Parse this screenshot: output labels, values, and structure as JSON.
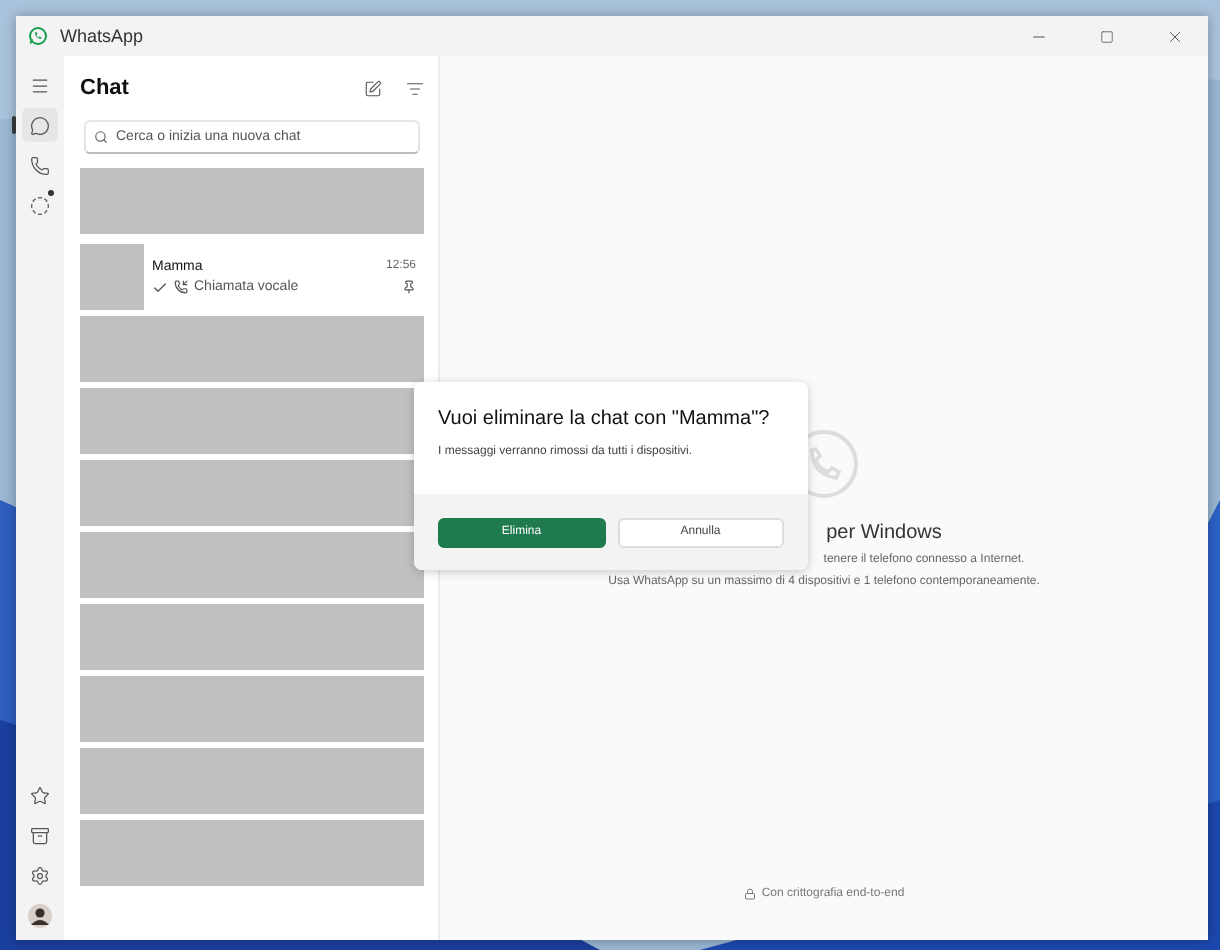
{
  "window": {
    "title": "WhatsApp"
  },
  "rail": {
    "top": [
      {
        "kind": "menu",
        "selected": false
      },
      {
        "kind": "chats",
        "selected": true
      },
      {
        "kind": "calls",
        "selected": false
      },
      {
        "kind": "status",
        "selected": false,
        "badge": true
      }
    ],
    "bottom": [
      {
        "kind": "starred",
        "selected": false
      },
      {
        "kind": "archived",
        "selected": false
      },
      {
        "kind": "settings",
        "selected": false
      },
      {
        "kind": "profile",
        "selected": false
      }
    ]
  },
  "chat_list": {
    "title": "Chat",
    "search": {
      "placeholder": "Cerca o inizia una nuova chat"
    },
    "chats": [
      {
        "kind": "hidden"
      },
      {
        "kind": "chat",
        "name": "Mamma",
        "time": "12:56",
        "preview": "Chiamata vocale",
        "read": true,
        "pinned": true
      },
      {
        "kind": "hidden"
      },
      {
        "kind": "hidden"
      },
      {
        "kind": "hidden"
      },
      {
        "kind": "hidden"
      },
      {
        "kind": "hidden"
      },
      {
        "kind": "hidden"
      },
      {
        "kind": "hidden"
      },
      {
        "kind": "hidden"
      }
    ]
  },
  "main": {
    "title": "per Windows",
    "lines": [
      "tenere il telefono connesso a Internet.",
      "Usa WhatsApp su un massimo di 4 dispositivi e 1 telefono contemporaneamente."
    ],
    "footer": "Con crittografia end-to-end"
  },
  "dialog": {
    "title": "Vuoi eliminare la chat con \"Mamma\"?",
    "message": "I messaggi verranno rimossi da tutti i dispositivi.",
    "buttons": [
      {
        "label": "Elimina",
        "kind": "primary"
      },
      {
        "label": "Annulla",
        "kind": "secondary"
      }
    ]
  }
}
